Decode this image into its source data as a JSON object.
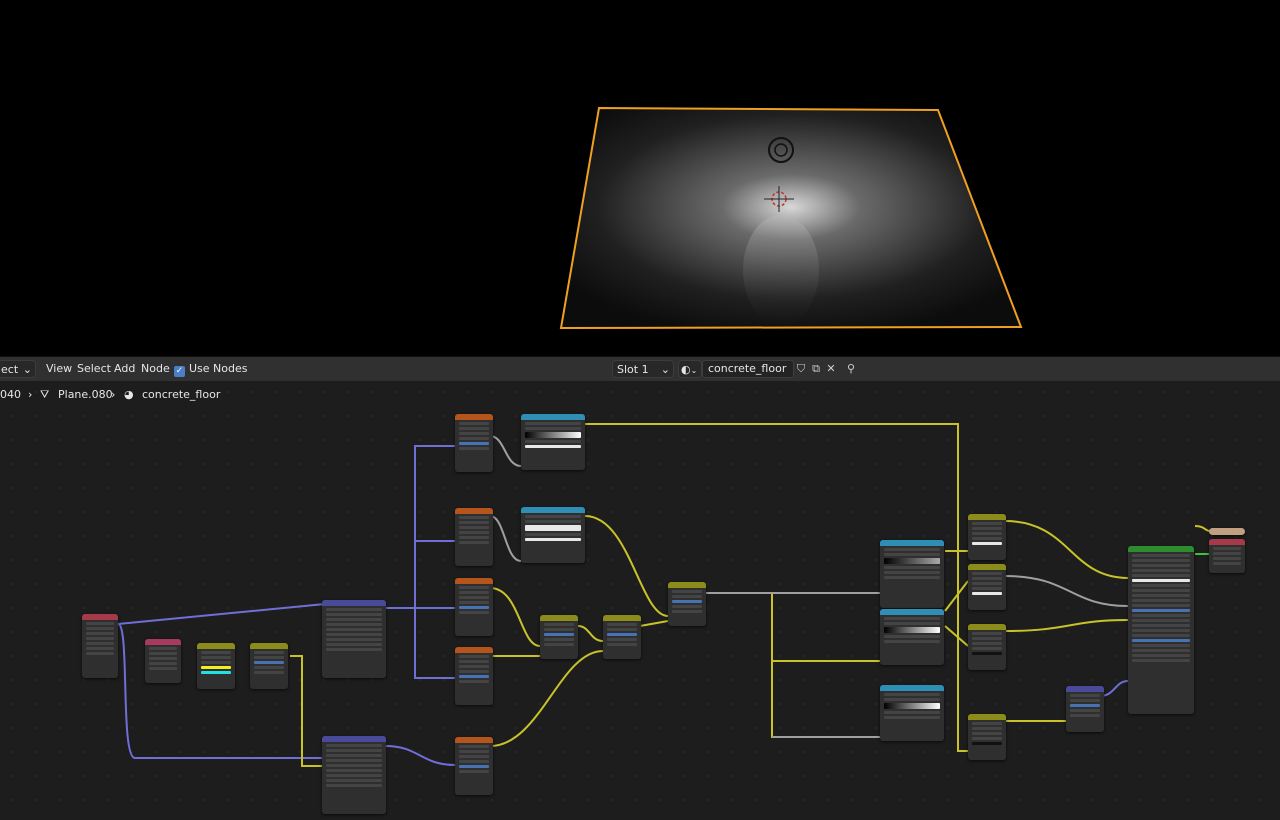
{
  "header": {
    "editor_type_label": "ect",
    "menu": [
      "View",
      "Select",
      "Add",
      "Node"
    ],
    "use_nodes_label": "Use Nodes",
    "slot_label": "Slot 1",
    "material_name": "concrete_floor"
  },
  "breadcrumb": {
    "object": "040",
    "mesh": "Plane.080",
    "material": "concrete_floor"
  },
  "colors": {
    "texture": "#b4561c",
    "converter": "#2f8eb3",
    "vector": "#4a4a9a",
    "shader": "#2d8c2d",
    "output": "#a63a4a",
    "color_mix": "#8c8c1a",
    "input": "#a63a60",
    "wire_yellow": "#c9c32a",
    "wire_gray": "#a0a0a0",
    "wire_purple": "#6f6fd8",
    "wire_green": "#3fc23f",
    "selection_outline": "#f0a020"
  }
}
